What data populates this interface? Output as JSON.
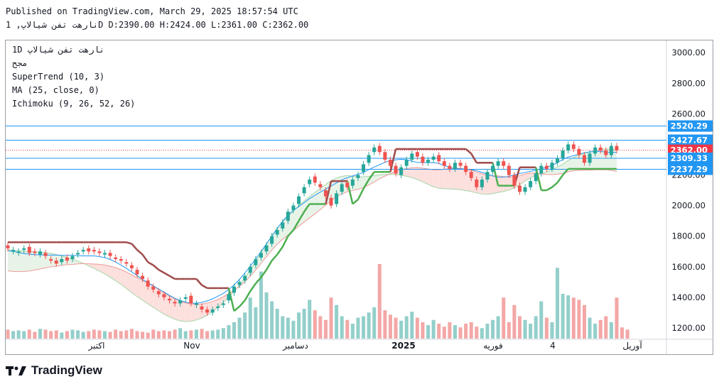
{
  "header": {
    "published": "Published on TradingView.com, March 29, 2025 18:57:54 UTC",
    "symbol_line": "نارهت تفن شيالاپ, 1D D:2390.00 H:2424.00 L:2361.00 C:2362.00"
  },
  "legend": {
    "symbol": "1D نارهت تفن شيالاپ",
    "exchange": "مجح",
    "supertrend": "SuperTrend (10, 3)",
    "ma": "MA (25, close, 0)",
    "ichimoku": "Ichimoku (9, 26, 52, 26)"
  },
  "brand": {
    "name": "TradingView"
  },
  "colors": {
    "up": "#26a69a",
    "down": "#ef5350",
    "supertrend_up": "#4caf50",
    "supertrend_down": "#a04a4a",
    "ma": "#2196f3",
    "cloud_bull": "#e8f3e8",
    "cloud_bear": "#fbe0de",
    "tag_blue": "#2196f3",
    "tag_red": "#f23645"
  },
  "chart_data": {
    "type": "candlestick",
    "y_axis": {
      "ticks": [
        1200,
        1400,
        1600,
        1800,
        2000,
        2200,
        2400,
        2600,
        2800,
        3000
      ],
      "range": [
        1130,
        3080
      ]
    },
    "x_axis": {
      "labels": [
        "اکتبر",
        "Nov",
        "دسامبر",
        "2025",
        "فوریه",
        "4",
        "آوریل"
      ]
    },
    "price_tags": [
      {
        "value": "2520.29",
        "kind": "blue"
      },
      {
        "value": "2427.67",
        "kind": "blue"
      },
      {
        "value": "2362.00",
        "kind": "red"
      },
      {
        "value": "2309.33",
        "kind": "blue"
      },
      {
        "value": "2237.29",
        "kind": "blue"
      }
    ],
    "ohlc_last": {
      "open": 2390,
      "high": 2424,
      "low": 2361,
      "close": 2362
    },
    "candles": [
      [
        1740,
        1720
      ],
      [
        1700,
        1710
      ],
      [
        1690,
        1700
      ],
      [
        1710,
        1720
      ],
      [
        1730,
        1690
      ],
      [
        1700,
        1690
      ],
      [
        1680,
        1700
      ],
      [
        1690,
        1670
      ],
      [
        1650,
        1640
      ],
      [
        1640,
        1620
      ],
      [
        1630,
        1650
      ],
      [
        1660,
        1640
      ],
      [
        1650,
        1670
      ],
      [
        1680,
        1690
      ],
      [
        1700,
        1710
      ],
      [
        1720,
        1700
      ],
      [
        1710,
        1700
      ],
      [
        1700,
        1690
      ],
      [
        1680,
        1690
      ],
      [
        1690,
        1670
      ],
      [
        1660,
        1650
      ],
      [
        1650,
        1640
      ],
      [
        1630,
        1620
      ],
      [
        1610,
        1590
      ],
      [
        1580,
        1550
      ],
      [
        1540,
        1520
      ],
      [
        1510,
        1470
      ],
      [
        1470,
        1450
      ],
      [
        1440,
        1420
      ],
      [
        1420,
        1400
      ],
      [
        1390,
        1380
      ],
      [
        1370,
        1360
      ],
      [
        1360,
        1380
      ],
      [
        1390,
        1400
      ],
      [
        1410,
        1360
      ],
      [
        1350,
        1360
      ],
      [
        1340,
        1320
      ],
      [
        1320,
        1300
      ],
      [
        1300,
        1320
      ],
      [
        1330,
        1340
      ],
      [
        1350,
        1360
      ],
      [
        1380,
        1420
      ],
      [
        1430,
        1470
      ],
      [
        1480,
        1500
      ],
      [
        1510,
        1540
      ],
      [
        1560,
        1600
      ],
      [
        1610,
        1650
      ],
      [
        1660,
        1690
      ],
      [
        1700,
        1740
      ],
      [
        1750,
        1800
      ],
      [
        1810,
        1840
      ],
      [
        1850,
        1890
      ],
      [
        1900,
        1960
      ],
      [
        1970,
        2000
      ],
      [
        2010,
        2060
      ],
      [
        2080,
        2120
      ],
      [
        2140,
        2170
      ],
      [
        2190,
        2150
      ],
      [
        2140,
        2120
      ],
      [
        2100,
        2060
      ],
      [
        2050,
        2000
      ],
      [
        2010,
        2080
      ],
      [
        2090,
        2140
      ],
      [
        2150,
        2120
      ],
      [
        2130,
        2170
      ],
      [
        2180,
        2200
      ],
      [
        2220,
        2270
      ],
      [
        2280,
        2330
      ],
      [
        2350,
        2380
      ],
      [
        2390,
        2350
      ],
      [
        2350,
        2300
      ],
      [
        2300,
        2260
      ],
      [
        2260,
        2210
      ],
      [
        2200,
        2250
      ],
      [
        2260,
        2300
      ],
      [
        2300,
        2340
      ],
      [
        2350,
        2320
      ],
      [
        2320,
        2280
      ],
      [
        2280,
        2300
      ],
      [
        2300,
        2320
      ],
      [
        2330,
        2290
      ],
      [
        2290,
        2260
      ],
      [
        2260,
        2240
      ],
      [
        2240,
        2280
      ],
      [
        2280,
        2260
      ],
      [
        2260,
        2220
      ],
      [
        2220,
        2180
      ],
      [
        2170,
        2120
      ],
      [
        2120,
        2170
      ],
      [
        2170,
        2220
      ],
      [
        2220,
        2260
      ],
      [
        2260,
        2290
      ],
      [
        2290,
        2260
      ],
      [
        2260,
        2200
      ],
      [
        2200,
        2130
      ],
      [
        2130,
        2090
      ],
      [
        2090,
        2120
      ],
      [
        2120,
        2160
      ],
      [
        2160,
        2210
      ],
      [
        2210,
        2260
      ],
      [
        2260,
        2240
      ],
      [
        2240,
        2280
      ],
      [
        2280,
        2310
      ],
      [
        2310,
        2360
      ],
      [
        2360,
        2400
      ],
      [
        2400,
        2370
      ],
      [
        2370,
        2330
      ],
      [
        2330,
        2280
      ],
      [
        2280,
        2340
      ],
      [
        2340,
        2380
      ],
      [
        2380,
        2360
      ],
      [
        2360,
        2330
      ],
      [
        2330,
        2390
      ],
      [
        2390,
        2362
      ]
    ],
    "volumes": [
      0.12,
      0.1,
      0.11,
      0.1,
      0.12,
      0.09,
      0.13,
      0.12,
      0.1,
      0.11,
      0.08,
      0.1,
      0.12,
      0.11,
      0.09,
      0.1,
      0.12,
      0.11,
      0.1,
      0.09,
      0.12,
      0.1,
      0.11,
      0.13,
      0.1,
      0.09,
      0.08,
      0.12,
      0.1,
      0.11,
      0.1,
      0.12,
      0.14,
      0.1,
      0.11,
      0.12,
      0.13,
      0.1,
      0.11,
      0.12,
      0.14,
      0.18,
      0.22,
      0.28,
      0.35,
      0.55,
      0.42,
      0.9,
      0.62,
      0.5,
      0.4,
      0.3,
      0.28,
      0.24,
      0.35,
      0.4,
      0.52,
      0.38,
      0.3,
      0.25,
      0.55,
      0.45,
      0.3,
      0.25,
      0.2,
      0.28,
      0.3,
      0.35,
      0.42,
      1.0,
      0.38,
      0.32,
      0.28,
      0.24,
      0.3,
      0.36,
      0.28,
      0.22,
      0.18,
      0.25,
      0.2,
      0.16,
      0.22,
      0.18,
      0.15,
      0.2,
      0.22,
      0.16,
      0.14,
      0.2,
      0.25,
      0.3,
      0.55,
      0.22,
      0.45,
      0.3,
      0.25,
      0.2,
      0.3,
      0.5,
      0.28,
      0.22,
      0.95,
      0.6,
      0.58,
      0.55,
      0.52,
      0.45,
      0.28,
      0.2,
      0.25,
      0.3,
      0.22,
      0.55,
      0.15,
      0.12
    ]
  }
}
